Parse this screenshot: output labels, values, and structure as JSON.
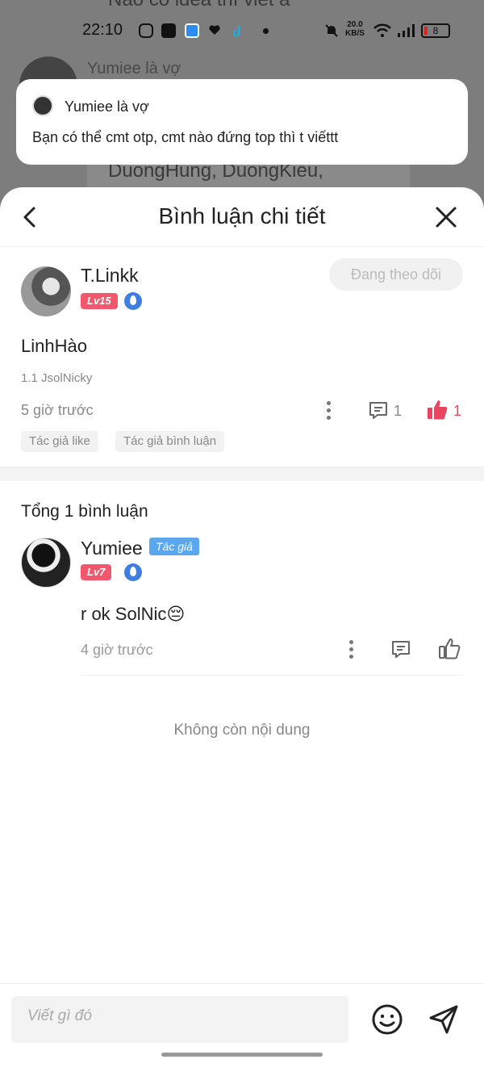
{
  "background": {
    "top_text": "Nào có idea thì viết á",
    "author_name": "Yumiee là vợ",
    "names_text": "DuongHung, DuongKieu,"
  },
  "status_bar": {
    "time": "22:10",
    "net_speed_top": "20.0",
    "net_speed_unit": "KB/S",
    "battery": "8"
  },
  "notification": {
    "title": "Yumiee là vợ",
    "body": "Bạn có thể cmt otp, cmt nào đứng top thì t viếttt"
  },
  "sheet": {
    "title": "Bình luận chi tiết"
  },
  "main_comment": {
    "username": "T.Linkk",
    "level": "Lv15",
    "follow_label": "Đang theo dõi",
    "content": "LinhHào",
    "quote": "1.1 JsolNicky",
    "time": "5 giờ trước",
    "comment_count": "1",
    "like_count": "1",
    "tags": [
      "Tác giả like",
      "Tác giả bình luận"
    ]
  },
  "total_label": "Tổng 1 bình luận",
  "reply": {
    "username": "Yumiee",
    "author_badge": "Tác giả",
    "level": "Lv7",
    "content": "r ok SolNic😔",
    "time": "4 giờ trước"
  },
  "end_label": "Không còn nội dung",
  "input": {
    "placeholder": "Viết gì đó"
  },
  "colors": {
    "accent_pink": "#f2576e",
    "author_blue": "#5aa7f0",
    "like_red": "#e8465e"
  }
}
